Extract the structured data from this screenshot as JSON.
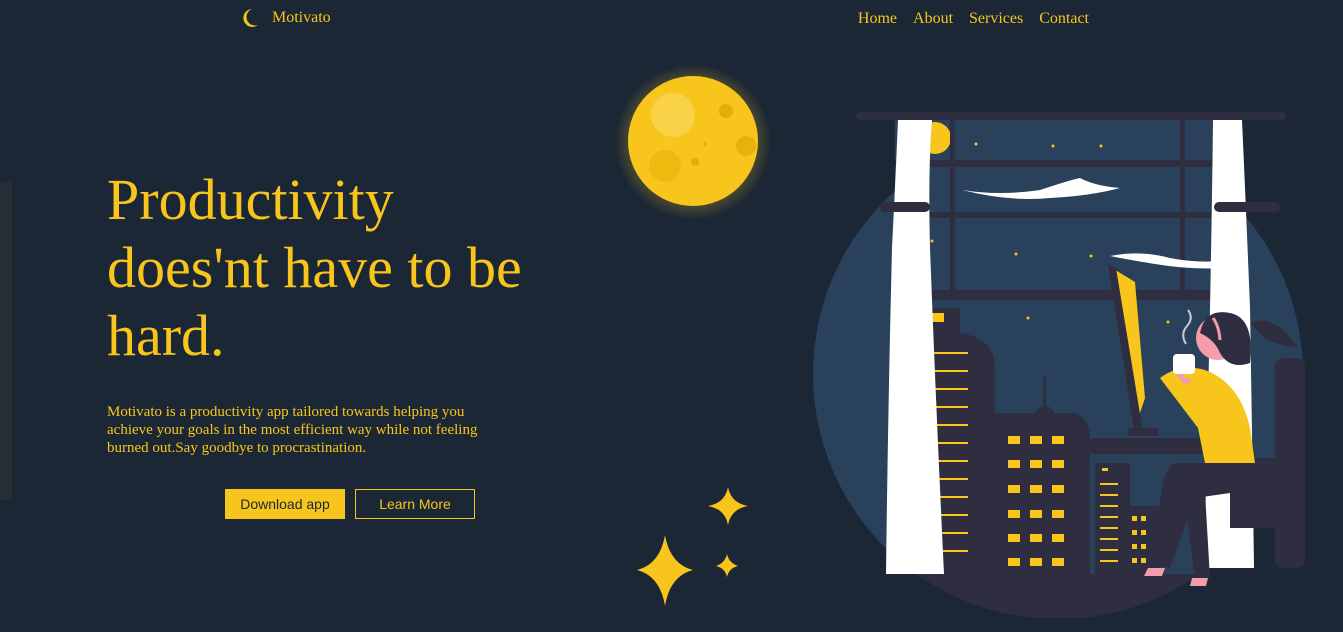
{
  "nav": {
    "brand": "Motivato",
    "links": [
      "Home",
      "About",
      "Services",
      "Contact"
    ]
  },
  "hero": {
    "title": "Productivity does'nt have to be hard.",
    "description": "Motivato is a productivity app tailored towards helping you achieve your goals in the most efficient way while not feeling burned out.Say goodbye to procrastination.",
    "primary_button": "Download app",
    "secondary_button": "Learn More"
  },
  "icons": {
    "logo": "crescent-moon-icon",
    "moon": "full-moon-illustration",
    "stars": "sparkle-stars-illustration",
    "scene": "woman-working-at-night-window-illustration"
  },
  "colors": {
    "background": "#1b2735",
    "accent": "#f8c51c",
    "circle": "#29415a",
    "dark_buildings": "#2f2e41"
  }
}
